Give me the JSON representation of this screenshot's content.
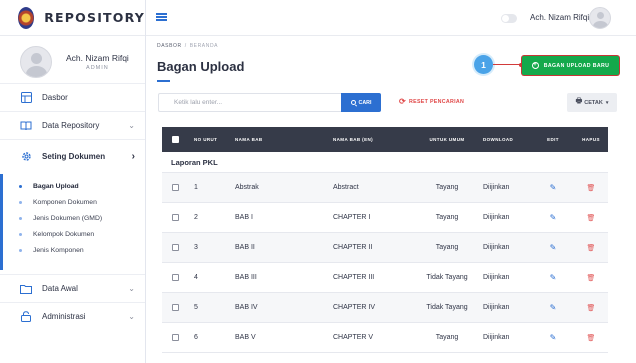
{
  "brand": {
    "name": "REPOSITORY"
  },
  "profile": {
    "name": "Ach. Nizam Rifqi",
    "role": "ADMIN"
  },
  "menu": {
    "dasbor": "Dasbor",
    "data_repository": "Data Repository",
    "seting_dokumen": "Seting Dokumen",
    "data_awal": "Data Awal",
    "administrasi": "Administrasi",
    "chevron_down": "⌄",
    "chevron_right": "›"
  },
  "submenu": [
    "Bagan Upload",
    "Komponen Dokumen",
    "Jenis Dokumen (GMD)",
    "Kelompok Dokumen",
    "Jenis Komponen"
  ],
  "topbar": {
    "user_name": "Ach. Nizam Rifqi"
  },
  "breadcrumb": {
    "home": "DASBOR",
    "separator": "/",
    "current": "BERANDA"
  },
  "page": {
    "title": "Bagan Upload"
  },
  "annotation": {
    "badge": "1"
  },
  "actions": {
    "add_label": "BAGAN UPLOAD BARU",
    "search_placeholder": "Ketik lalu enter...",
    "search_label": "CARI",
    "reset_label": "RESET PENCARIAN",
    "print_label": "CETAK"
  },
  "table": {
    "headers": {
      "no": "NO URUT",
      "nama": "NAMA BAB",
      "nama_en": "NAMA BAB (EN)",
      "umum": "UNTUK UMUM",
      "download": "DOWNLOAD",
      "edit": "EDIT",
      "hapus": "HAPUS"
    },
    "group": "Laporan PKL",
    "rows": [
      {
        "no": "1",
        "nama": "Abstrak",
        "nama_en": "Abstract",
        "umum": "Tayang",
        "download": "Diijinkan"
      },
      {
        "no": "2",
        "nama": "BAB I",
        "nama_en": "CHAPTER I",
        "umum": "Tayang",
        "download": "Diijinkan"
      },
      {
        "no": "3",
        "nama": "BAB II",
        "nama_en": "CHAPTER II",
        "umum": "Tayang",
        "download": "Diijinkan"
      },
      {
        "no": "4",
        "nama": "BAB III",
        "nama_en": "CHAPTER III",
        "umum": "Tidak Tayang",
        "download": "Diijinkan"
      },
      {
        "no": "5",
        "nama": "BAB IV",
        "nama_en": "CHAPTER IV",
        "umum": "Tidak Tayang",
        "download": "Diijinkan"
      },
      {
        "no": "6",
        "nama": "BAB V",
        "nama_en": "CHAPTER V",
        "umum": "Tayang",
        "download": "Diijinkan"
      }
    ]
  },
  "colors": {
    "primary": "#2c6fd1",
    "success": "#14a94b",
    "danger": "#e04848",
    "table_header": "#363b49"
  }
}
